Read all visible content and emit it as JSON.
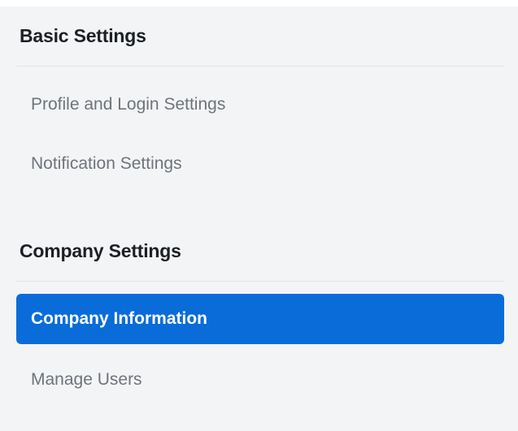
{
  "basic_settings": {
    "title": "Basic Settings",
    "items": [
      {
        "label": "Profile and Login Settings"
      },
      {
        "label": "Notification Settings"
      }
    ]
  },
  "company_settings": {
    "title": "Company Settings",
    "items": [
      {
        "label": "Company Information",
        "active": true
      },
      {
        "label": "Manage Users"
      }
    ]
  },
  "colors": {
    "accent": "#0a6cd9",
    "panel_bg": "#f3f4f6",
    "heading": "#1c2024",
    "item_text": "#6f747a"
  }
}
